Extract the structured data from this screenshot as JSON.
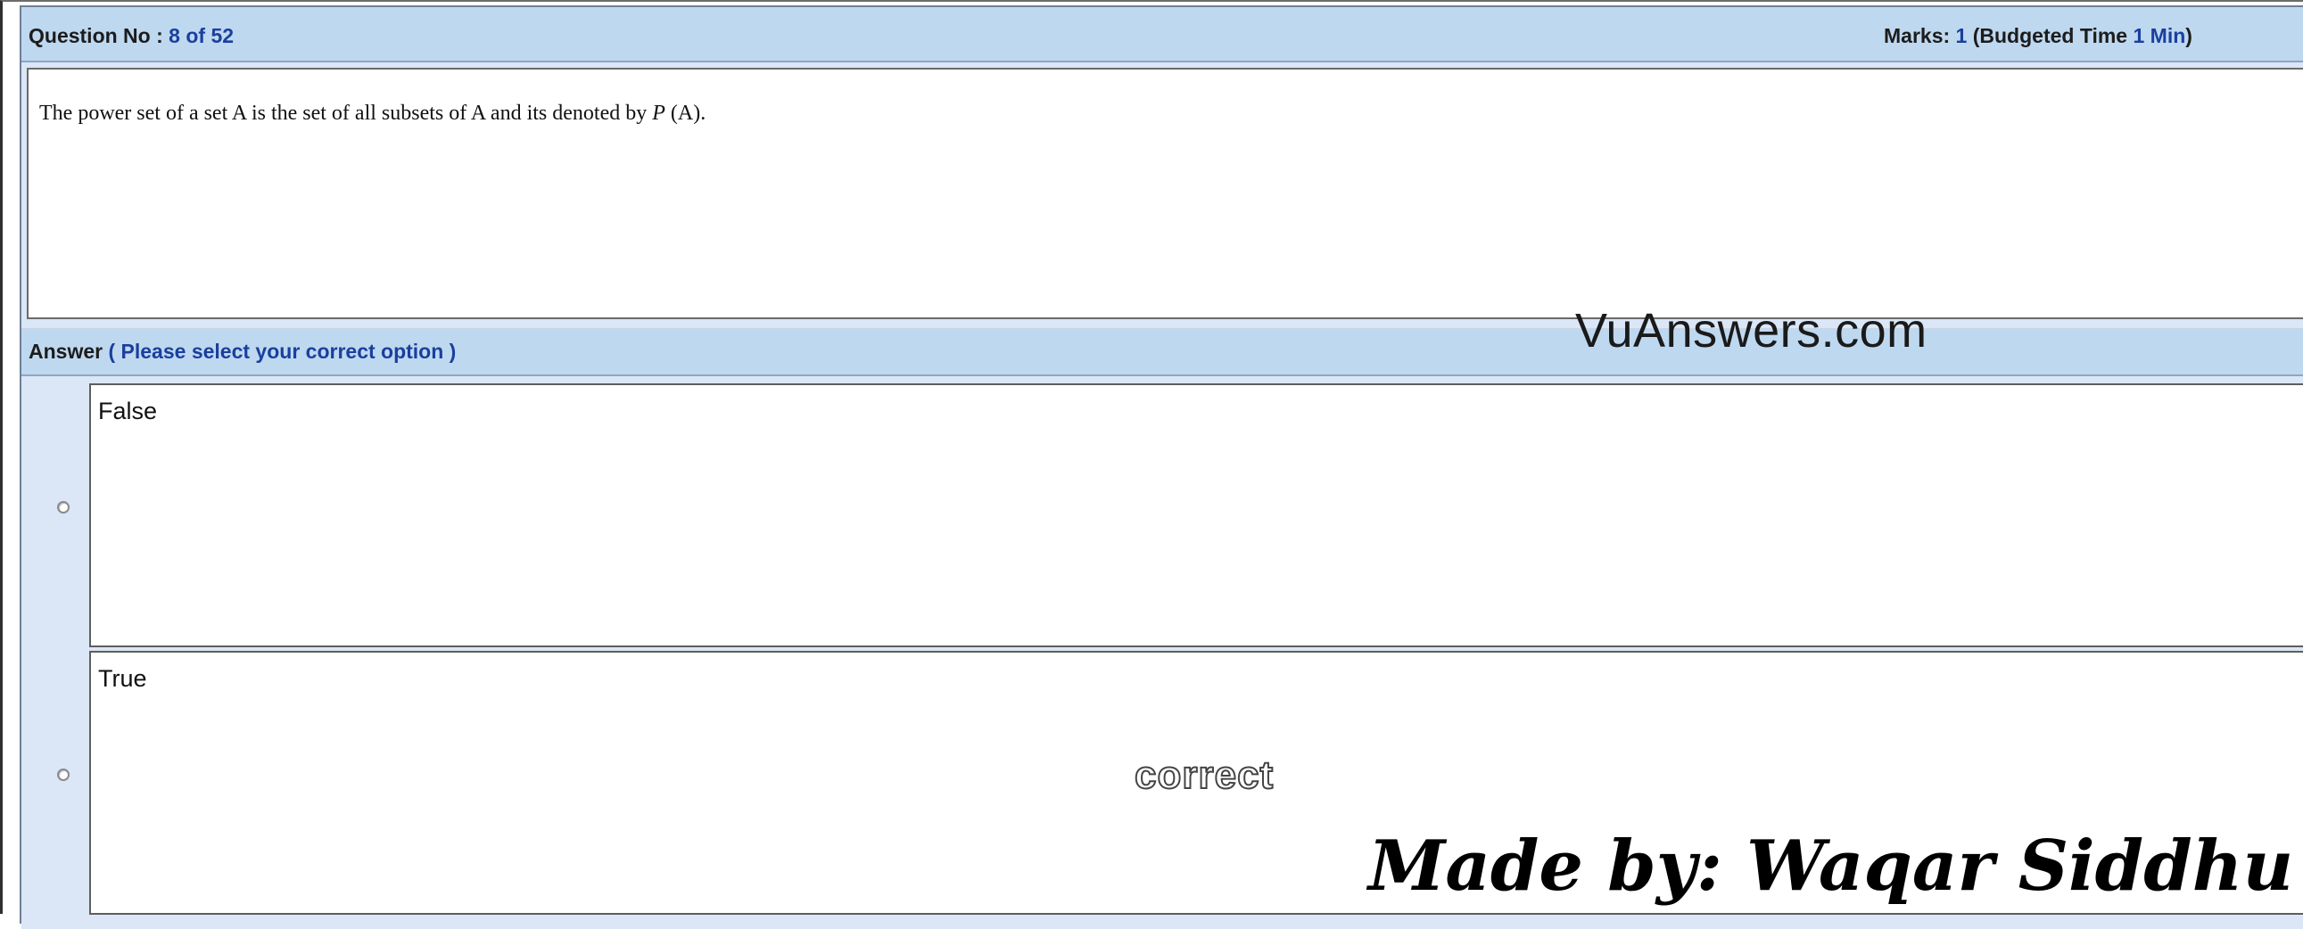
{
  "header": {
    "question_label": "Question No : ",
    "question_number": "8 of 52",
    "marks_label": "Marks: ",
    "marks_value": "1",
    "budget_label": " (Budgeted Time ",
    "budget_value": "1 Min",
    "budget_close": ")"
  },
  "question": {
    "text_before": "The power set of a set A is the set of all subsets of A and its denoted by ",
    "symbol": "P",
    "text_after": " (A)."
  },
  "answer_section": {
    "label": "Answer",
    "hint": " ( Please select your correct option )"
  },
  "options": [
    {
      "label": "False",
      "selected": false
    },
    {
      "label": "True",
      "selected": false
    }
  ],
  "watermarks": {
    "site": "VuAnswers.com",
    "correct_mark": "correct",
    "author": "Made by: Waqar Siddhu"
  },
  "colors": {
    "bar_background": "#bed8f0",
    "panel_background": "#dbe7f6",
    "accent_blue": "#1a3f9e"
  }
}
